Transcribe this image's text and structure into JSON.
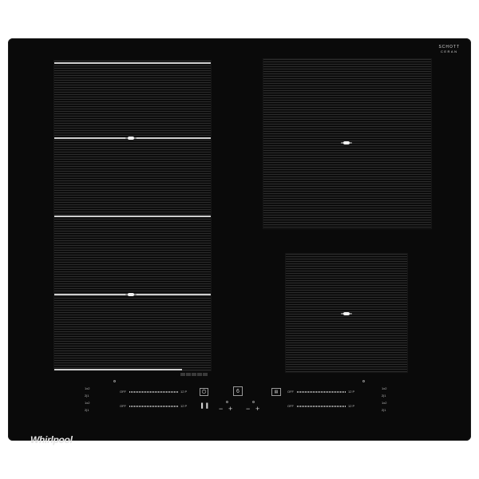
{
  "brand": {
    "logo": "Whirlpool",
    "glass_line1": "SCHOTT",
    "glass_line2": "CERAN"
  },
  "controls": {
    "left_slider_top": {
      "min_label": "OFF",
      "max_label": "12 P"
    },
    "left_slider_bottom": {
      "min_label": "OFF",
      "max_label": "12 P"
    },
    "right_slider_top": {
      "min_label": "OFF",
      "max_label": "12 P"
    },
    "right_slider_bottom": {
      "min_label": "OFF",
      "max_label": "12 P"
    },
    "left_indicators": [
      "1x2",
      "2|1",
      "1x2",
      "2|1"
    ],
    "right_indicators": [
      "1x2",
      "2|1",
      "1x2",
      "2|1"
    ],
    "power_symbol": "⏻",
    "timer_minus": "−",
    "timer_plus": "+",
    "boost_symbol": "6",
    "lock_symbol": "🔒︎",
    "minus": "−",
    "plus": "+"
  },
  "colors": {
    "glass": "#0a0a0a",
    "markings": "#d0d0d0"
  },
  "icons": [
    "power-icon",
    "boost-icon",
    "lock-icon",
    "pause-icon",
    "timer-icon"
  ]
}
